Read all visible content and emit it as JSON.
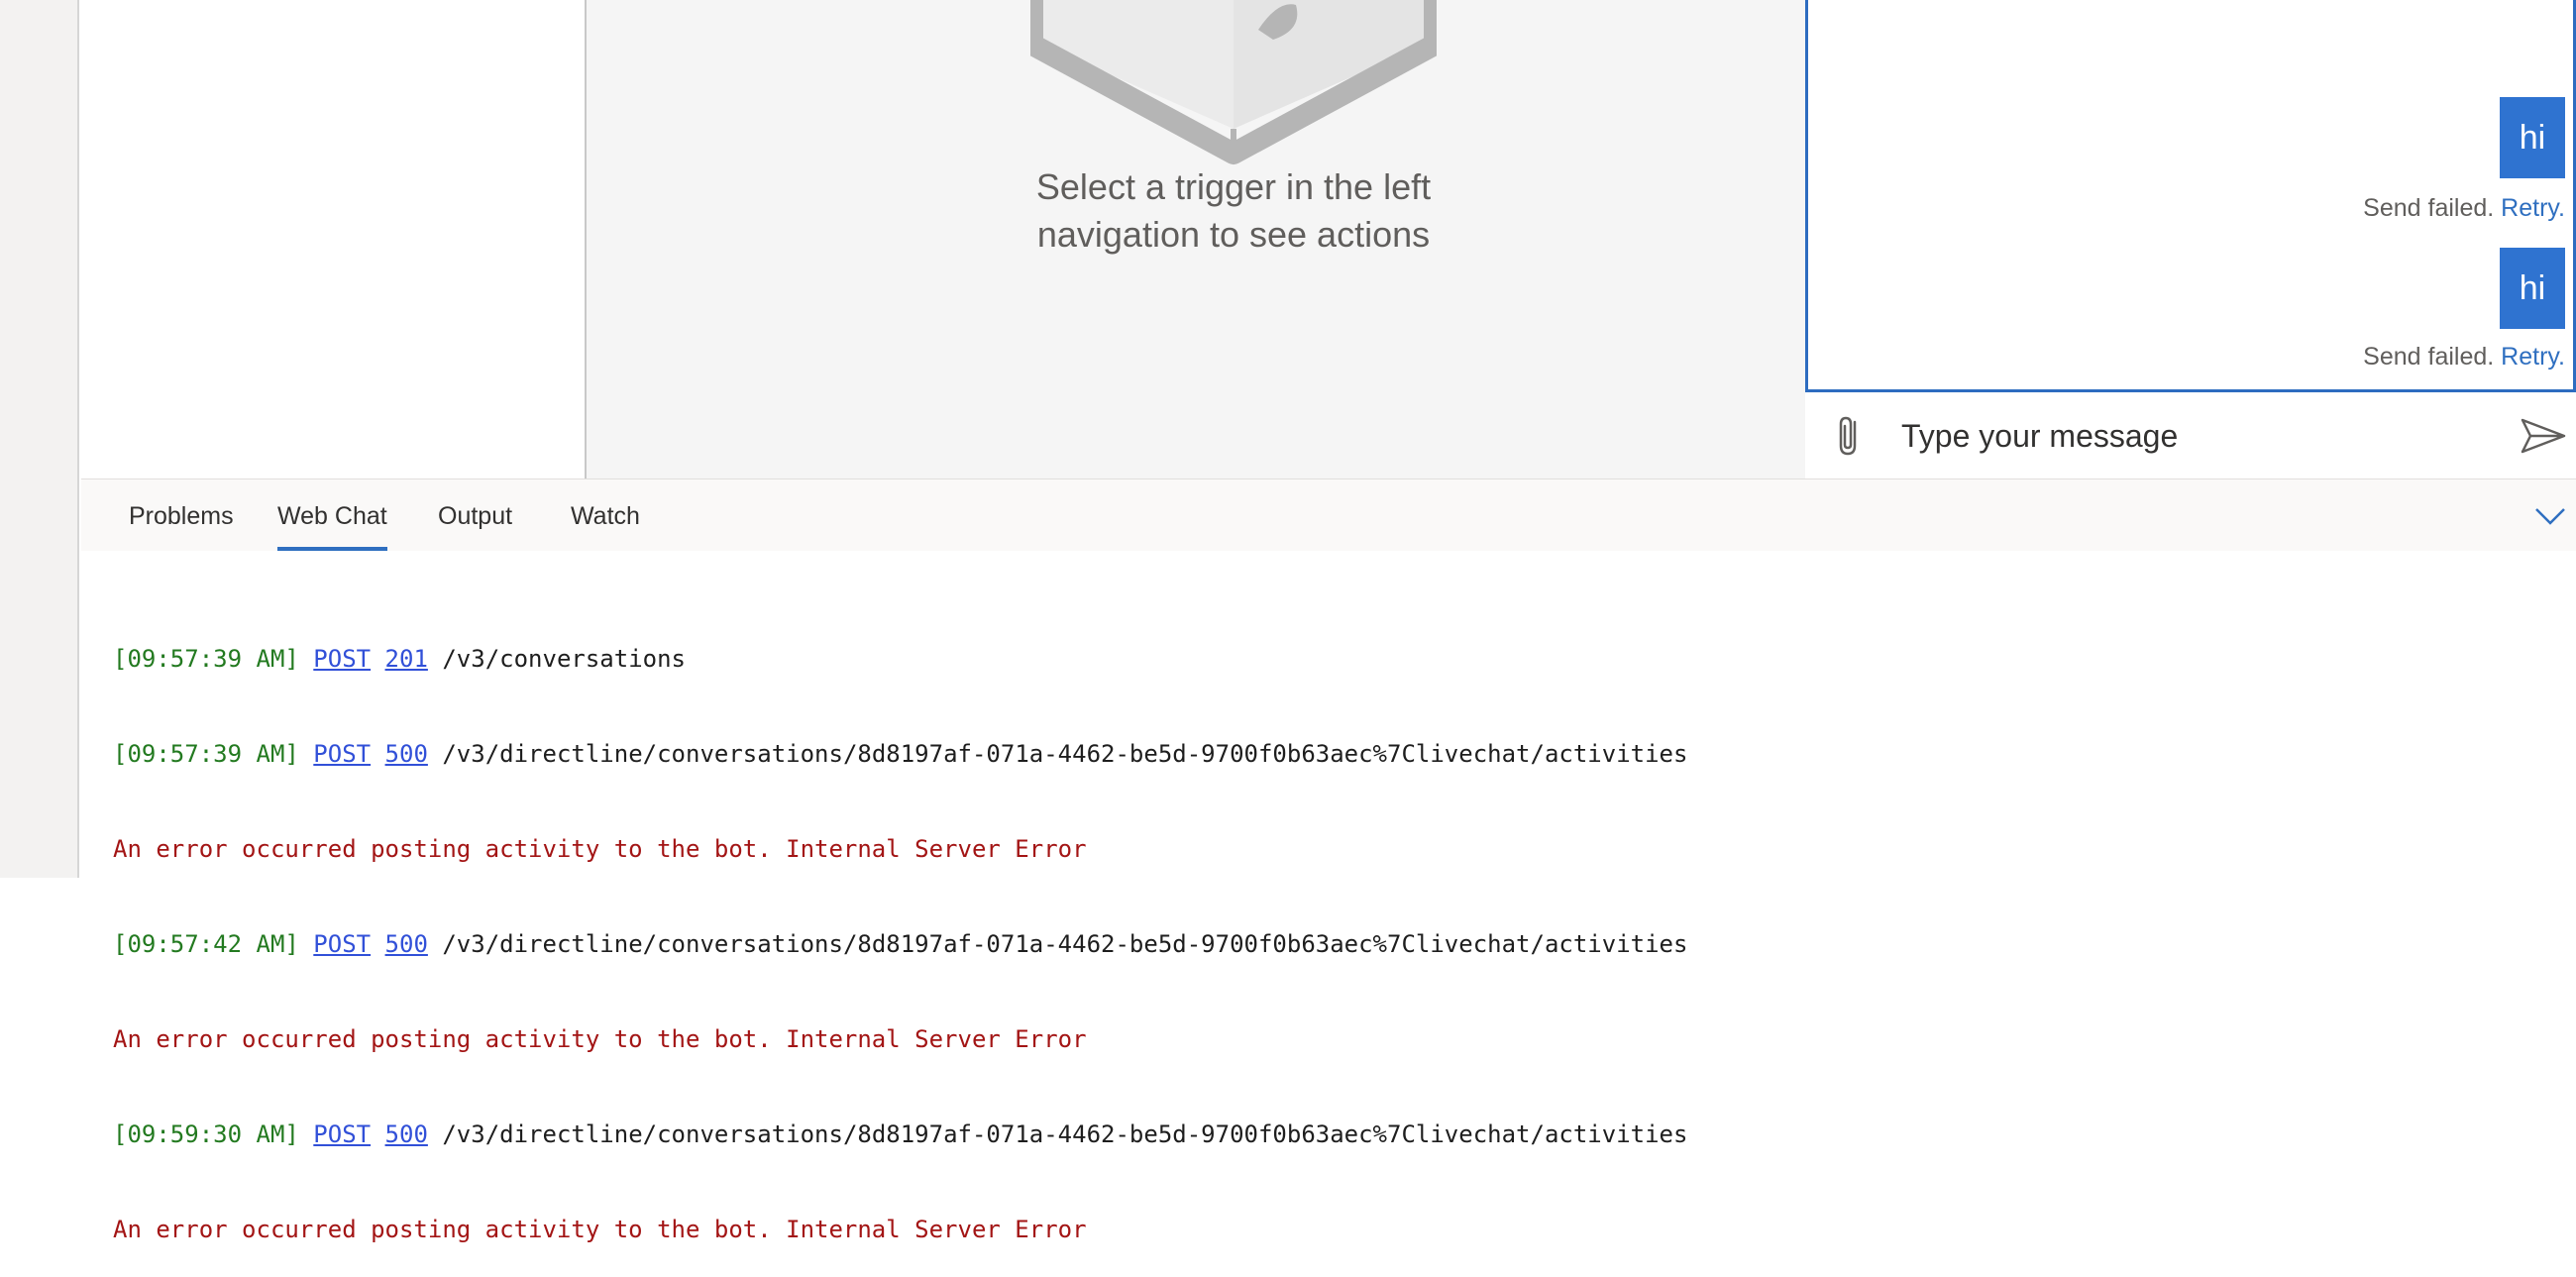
{
  "canvas": {
    "empty_line1": "Select a trigger in the left",
    "empty_line2": "navigation to see actions"
  },
  "chat": {
    "messages": [
      {
        "text": "hi",
        "status": "Send failed.",
        "retry": "Retry."
      },
      {
        "text": "hi",
        "status": "Send failed.",
        "retry": "Retry."
      }
    ],
    "input_placeholder": "Type your message",
    "attach_icon": "paperclip-icon",
    "send_icon": "send-icon",
    "accent_color": "#2f73d0"
  },
  "panel": {
    "tabs": [
      "Problems",
      "Web Chat",
      "Output",
      "Watch"
    ],
    "active_tab": "Web Chat",
    "collapse_icon": "chevron-down-icon"
  },
  "log": {
    "lines": [
      {
        "ts": "[09:57:39 AM]",
        "method": "POST",
        "code": "201",
        "path": "/v3/conversations"
      },
      {
        "ts": "[09:57:39 AM]",
        "method": "POST",
        "code": "500",
        "path": "/v3/directline/conversations/8d8197af-071a-4462-be5d-9700f0b63aec%7Clivechat/activities"
      },
      {
        "error": "An error occurred posting activity to the bot. Internal Server Error"
      },
      {
        "ts": "[09:57:42 AM]",
        "method": "POST",
        "code": "500",
        "path": "/v3/directline/conversations/8d8197af-071a-4462-be5d-9700f0b63aec%7Clivechat/activities"
      },
      {
        "error": "An error occurred posting activity to the bot. Internal Server Error"
      },
      {
        "ts": "[09:59:30 AM]",
        "method": "POST",
        "code": "500",
        "path": "/v3/directline/conversations/8d8197af-071a-4462-be5d-9700f0b63aec%7Clivechat/activities"
      },
      {
        "error": "An error occurred posting activity to the bot. Internal Server Error"
      }
    ],
    "colors": {
      "timestamp": "#237a20",
      "link": "#3150d8",
      "error": "#a31515"
    }
  }
}
